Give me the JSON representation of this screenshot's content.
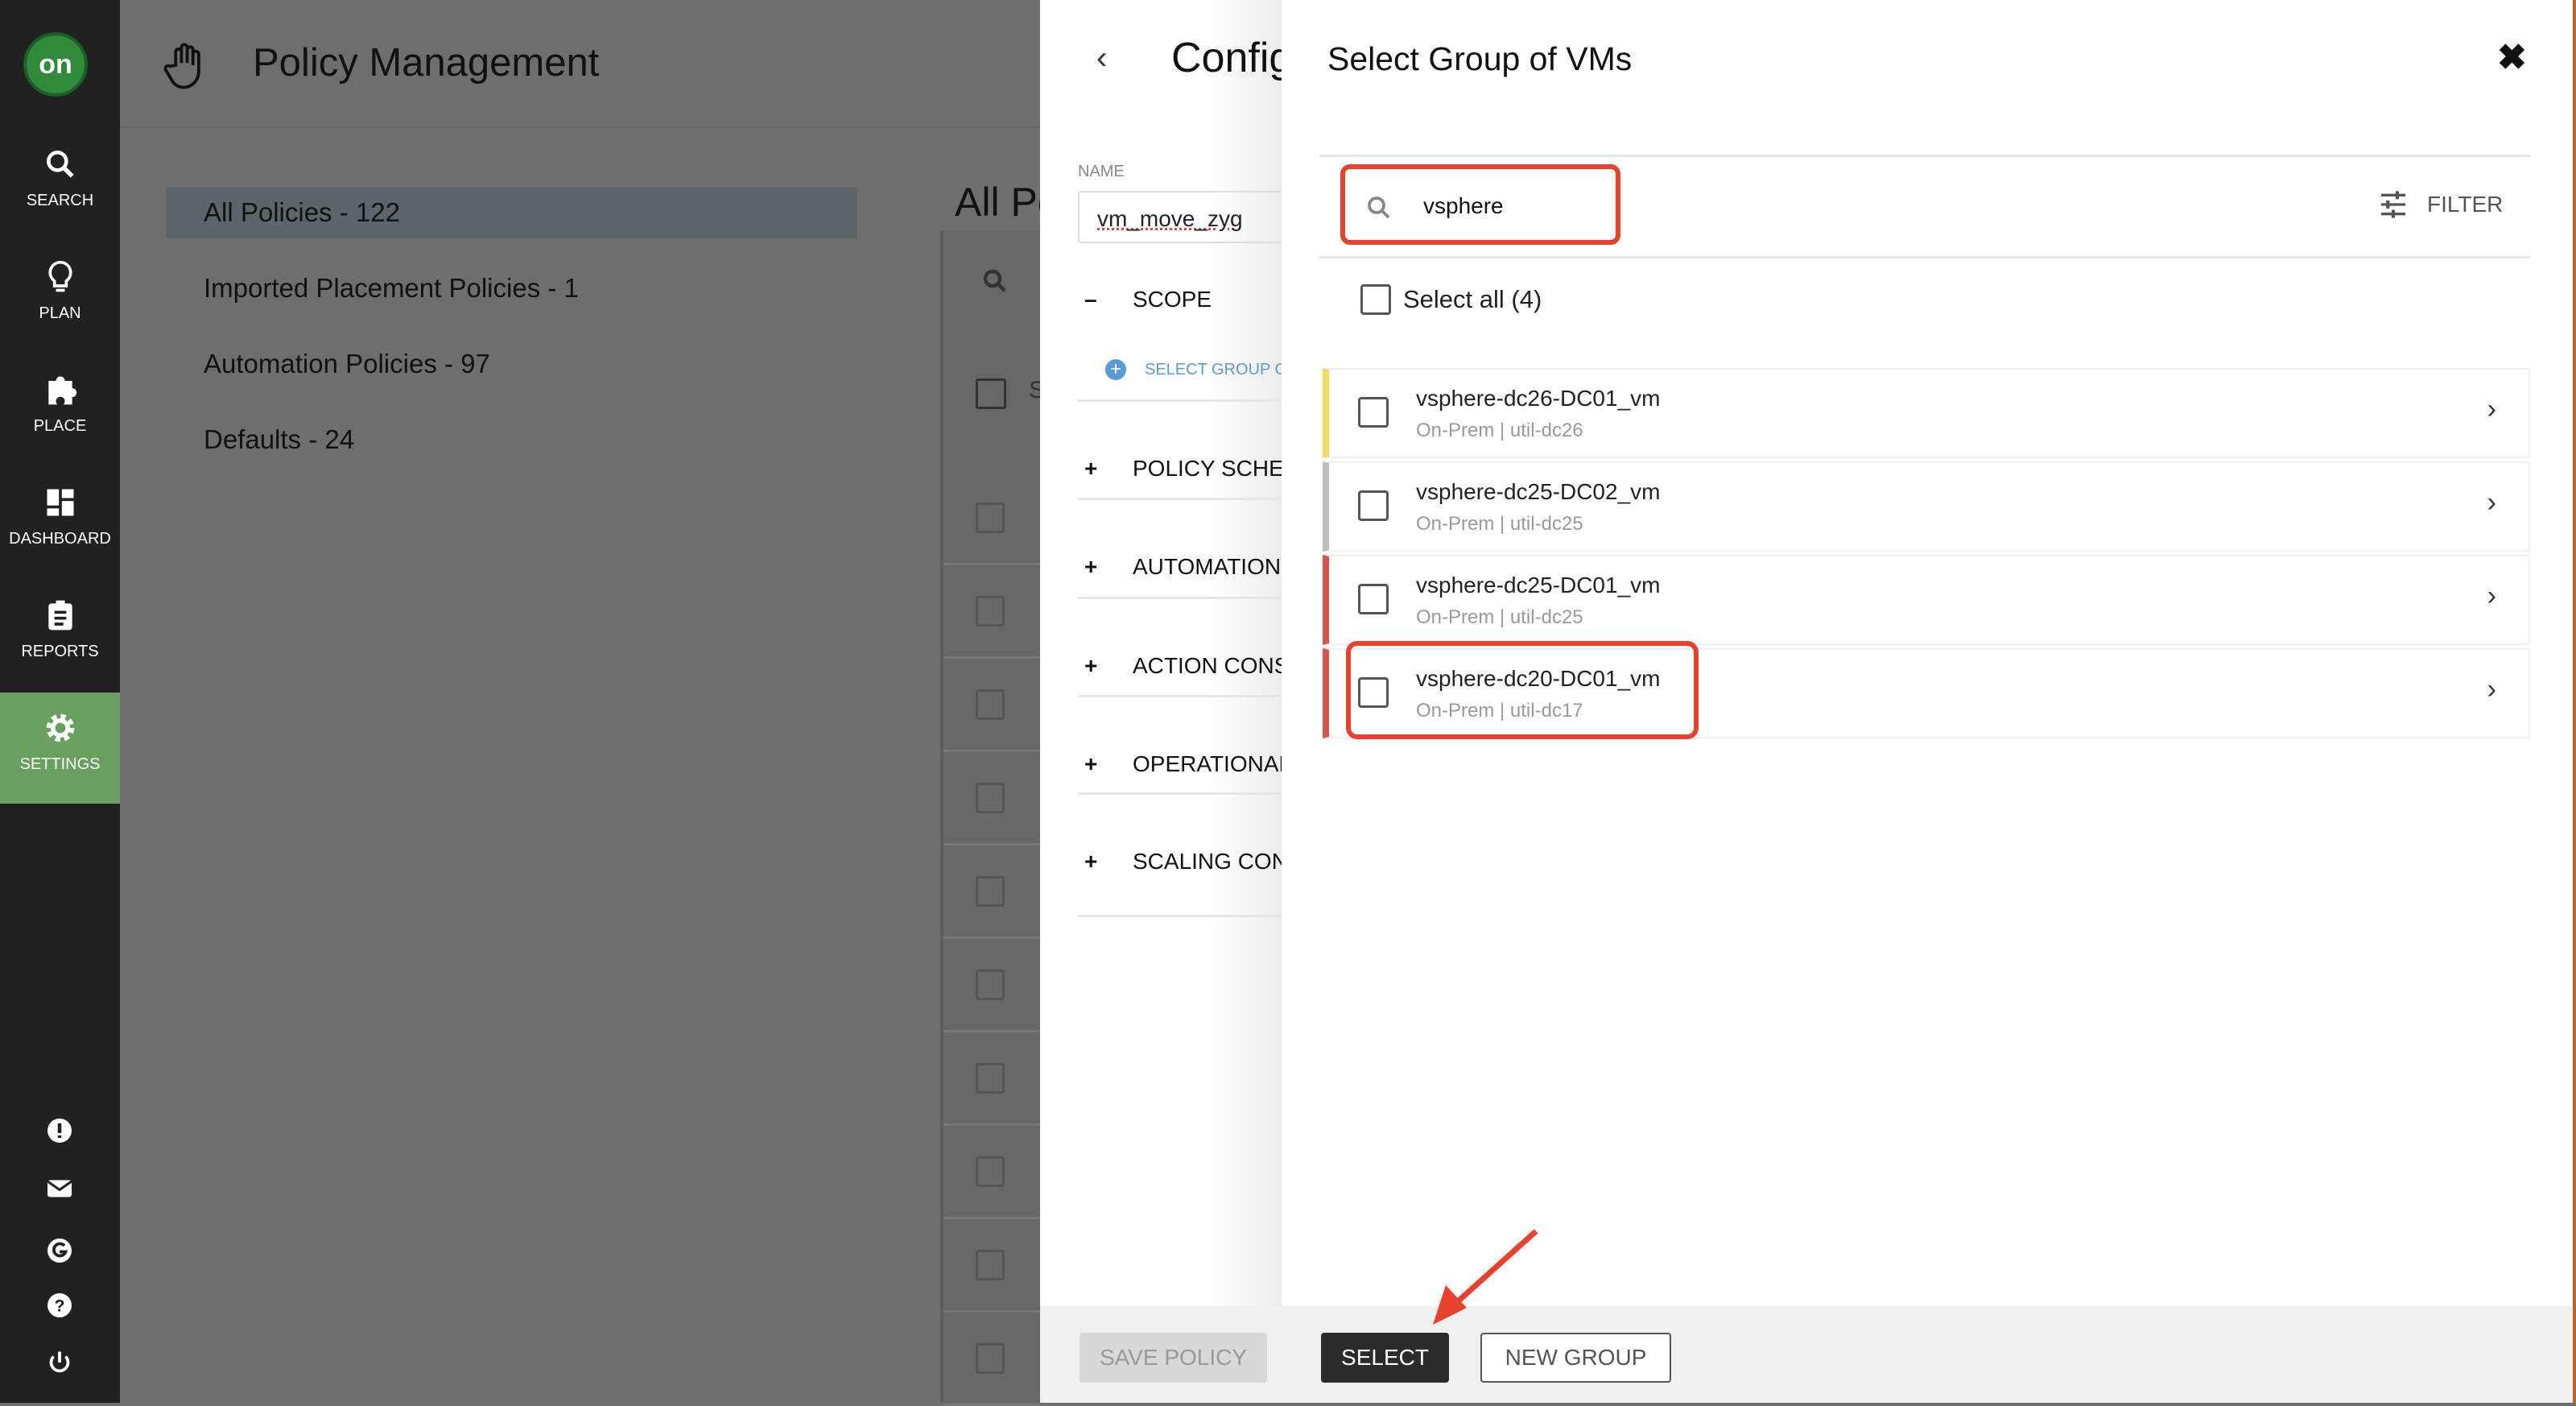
{
  "sidebar": {
    "logo": "on",
    "items": [
      {
        "label": "SEARCH",
        "icon": "search-icon"
      },
      {
        "label": "PLAN",
        "icon": "lightbulb-icon"
      },
      {
        "label": "PLACE",
        "icon": "puzzle-icon"
      },
      {
        "label": "DASHBOARD",
        "icon": "dashboard-icon"
      },
      {
        "label": "REPORTS",
        "icon": "clipboard-icon"
      },
      {
        "label": "SETTINGS",
        "icon": "gear-icon",
        "active": true
      }
    ],
    "bottom_icons": [
      "alert-icon",
      "mail-icon",
      "g-icon",
      "help-icon",
      "power-icon"
    ]
  },
  "header": {
    "title": "Policy Management"
  },
  "policy_list": {
    "items": [
      "All Policies - 122",
      "Imported Placement Policies - 1",
      "Automation Policies - 97",
      "Defaults - 24"
    ]
  },
  "table": {
    "title": "All Po",
    "select_partial": "S"
  },
  "config": {
    "title": "Config",
    "name_label": "NAME",
    "name_value": "vm_move_zyg",
    "scope_label": "SCOPE",
    "select_group_link": "SELECT GROUP OF",
    "sections": [
      "POLICY SCHED",
      "AUTOMATION",
      "ACTION CONS",
      "OPERATIONAL",
      "SCALING CON"
    ],
    "save_label": "SAVE POLICY"
  },
  "dialog": {
    "title": "Select Group of VMs",
    "search_value": "vsphere",
    "filter_label": "FILTER",
    "select_all": "Select all (4)",
    "rows": [
      {
        "name": "vsphere-dc26-DC01_vm",
        "sub": "On-Prem | util-dc26",
        "color": "#f2dc5d"
      },
      {
        "name": "vsphere-dc25-DC02_vm",
        "sub": "On-Prem | util-dc25",
        "color": "#bdbdbd"
      },
      {
        "name": "vsphere-dc25-DC01_vm",
        "sub": "On-Prem | util-dc25",
        "color": "#d9534f"
      },
      {
        "name": "vsphere-dc20-DC01_vm",
        "sub": "On-Prem | util-dc17",
        "color": "#d9534f"
      }
    ],
    "select_label": "SELECT",
    "new_group_label": "NEW GROUP"
  },
  "colors": {
    "annotation": "#e8412c",
    "sidebar_active": "#6aa05f"
  }
}
